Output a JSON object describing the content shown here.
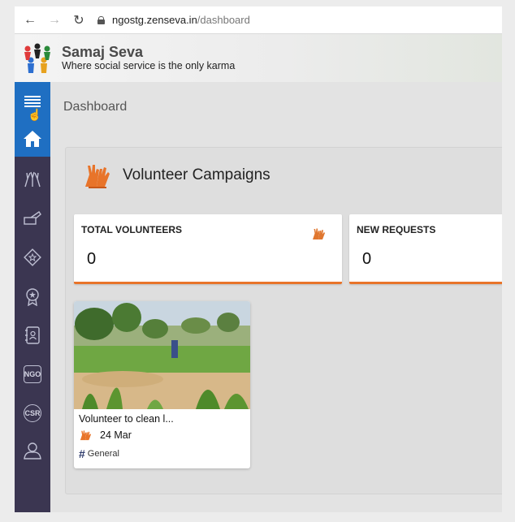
{
  "browser": {
    "url_host": "ngostg.zenseva.in",
    "url_path": "/dashboard"
  },
  "header": {
    "brand_name": "Samaj Seva",
    "tagline": "Where social service is the only karma"
  },
  "sidebar": {
    "items": [
      {
        "icon": "menu-icon"
      },
      {
        "icon": "home-icon",
        "active": true
      },
      {
        "icon": "volunteer-hands-icon"
      },
      {
        "icon": "donation-icon"
      },
      {
        "icon": "star-tag-icon"
      },
      {
        "icon": "award-icon"
      },
      {
        "icon": "contacts-book-icon"
      },
      {
        "icon": "ngo-icon",
        "label": "NGO"
      },
      {
        "icon": "csr-icon",
        "label": "CSR"
      },
      {
        "icon": "users-icon"
      }
    ]
  },
  "main": {
    "page_title": "Dashboard",
    "panel_title": "Volunteer Campaigns",
    "stats": [
      {
        "label": "TOTAL VOLUNTEERS",
        "value": "0"
      },
      {
        "label": "NEW REQUESTS",
        "value": "0"
      }
    ],
    "campaign": {
      "title": "Volunteer to clean l...",
      "date": "24 Mar",
      "tag": "General"
    }
  },
  "colors": {
    "accent_orange": "#e8742a",
    "sidebar_bg": "#3b3651",
    "active_blue": "#1f6fc2"
  }
}
